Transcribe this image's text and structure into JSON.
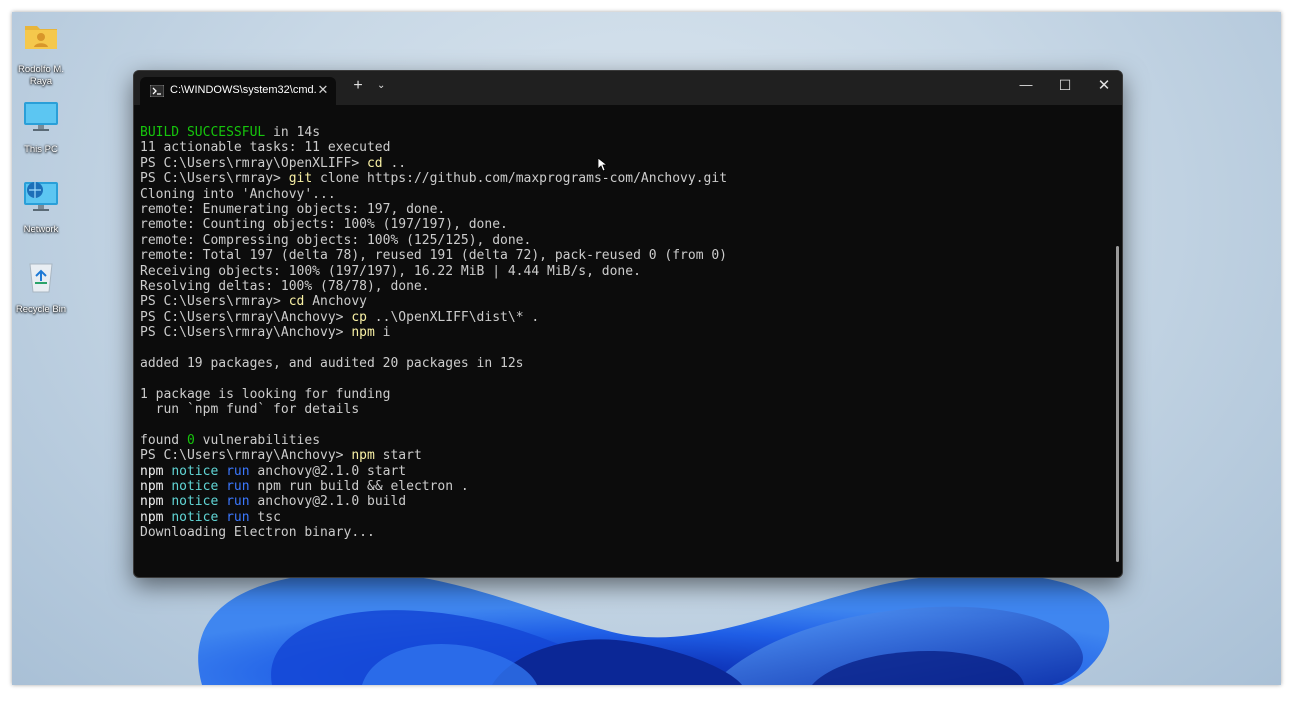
{
  "desktop": {
    "icons": [
      {
        "label": "Rodolfo M. Raya",
        "icon": "user-folder-icon"
      },
      {
        "label": "This PC",
        "icon": "monitor-icon"
      },
      {
        "label": "Network",
        "icon": "network-icon"
      },
      {
        "label": "Recycle Bin",
        "icon": "recycle-bin-icon"
      }
    ]
  },
  "terminal": {
    "tab_title": "C:\\WINDOWS\\system32\\cmd.",
    "tab_close": "✕",
    "new_tab": "+",
    "tab_dropdown": "⌄",
    "minimize": "—",
    "maximize": "☐",
    "close": "✕",
    "lines": [
      [
        {
          "t": "BUILD SUCCESSFUL",
          "c": "green"
        },
        {
          "t": " in 14s"
        }
      ],
      [
        {
          "t": "11 actionable tasks: 11 executed"
        }
      ],
      [
        {
          "t": "PS C:\\Users\\rmray\\OpenXLIFF> "
        },
        {
          "t": "cd",
          "c": "yellow"
        },
        {
          "t": " .."
        }
      ],
      [
        {
          "t": "PS C:\\Users\\rmray> "
        },
        {
          "t": "git",
          "c": "yellow"
        },
        {
          "t": " clone https://github.com/maxprograms-com/Anchovy.git"
        }
      ],
      [
        {
          "t": "Cloning into 'Anchovy'..."
        }
      ],
      [
        {
          "t": "remote: Enumerating objects: 197, done."
        }
      ],
      [
        {
          "t": "remote: Counting objects: 100% (197/197), done."
        }
      ],
      [
        {
          "t": "remote: Compressing objects: 100% (125/125), done."
        }
      ],
      [
        {
          "t": "remote: Total 197 (delta 78), reused 191 (delta 72), pack-reused 0 (from 0)"
        }
      ],
      [
        {
          "t": "Receiving objects: 100% (197/197), 16.22 MiB | 4.44 MiB/s, done."
        }
      ],
      [
        {
          "t": "Resolving deltas: 100% (78/78), done."
        }
      ],
      [
        {
          "t": "PS C:\\Users\\rmray> "
        },
        {
          "t": "cd",
          "c": "yellow"
        },
        {
          "t": " Anchovy"
        }
      ],
      [
        {
          "t": "PS C:\\Users\\rmray\\Anchovy> "
        },
        {
          "t": "cp",
          "c": "yellow"
        },
        {
          "t": " ..\\OpenXLIFF\\dist\\* ."
        }
      ],
      [
        {
          "t": "PS C:\\Users\\rmray\\Anchovy> "
        },
        {
          "t": "npm",
          "c": "yellow"
        },
        {
          "t": " i"
        }
      ],
      [
        {
          "t": ""
        }
      ],
      [
        {
          "t": "added 19 packages, and audited 20 packages in 12s"
        }
      ],
      [
        {
          "t": ""
        }
      ],
      [
        {
          "t": "1 package is looking for funding"
        }
      ],
      [
        {
          "t": "  run `npm fund` for details"
        }
      ],
      [
        {
          "t": ""
        }
      ],
      [
        {
          "t": "found "
        },
        {
          "t": "0",
          "c": "green"
        },
        {
          "t": " vulnerabilities"
        }
      ],
      [
        {
          "t": "PS C:\\Users\\rmray\\Anchovy> "
        },
        {
          "t": "npm",
          "c": "yellow"
        },
        {
          "t": " start"
        }
      ],
      [
        {
          "t": "npm",
          "c": "white"
        },
        {
          "t": " "
        },
        {
          "t": "notice",
          "c": "teal"
        },
        {
          "t": " "
        },
        {
          "t": "run",
          "c": "blue"
        },
        {
          "t": " anchovy@2.1.0 start"
        }
      ],
      [
        {
          "t": "npm",
          "c": "white"
        },
        {
          "t": " "
        },
        {
          "t": "notice",
          "c": "teal"
        },
        {
          "t": " "
        },
        {
          "t": "run",
          "c": "blue"
        },
        {
          "t": " npm run build && electron ."
        }
      ],
      [
        {
          "t": "npm",
          "c": "white"
        },
        {
          "t": " "
        },
        {
          "t": "notice",
          "c": "teal"
        },
        {
          "t": " "
        },
        {
          "t": "run",
          "c": "blue"
        },
        {
          "t": " anchovy@2.1.0 build"
        }
      ],
      [
        {
          "t": "npm",
          "c": "white"
        },
        {
          "t": " "
        },
        {
          "t": "notice",
          "c": "teal"
        },
        {
          "t": " "
        },
        {
          "t": "run",
          "c": "blue"
        },
        {
          "t": " tsc"
        }
      ],
      [
        {
          "t": "Downloading Electron binary..."
        }
      ]
    ]
  },
  "colors": {
    "terminal_bg": "#0c0c0c",
    "titlebar_bg": "#202020",
    "green": "#16c60c",
    "yellow": "#f9f1a5",
    "teal": "#61d6d6",
    "blue": "#3b78ff"
  }
}
